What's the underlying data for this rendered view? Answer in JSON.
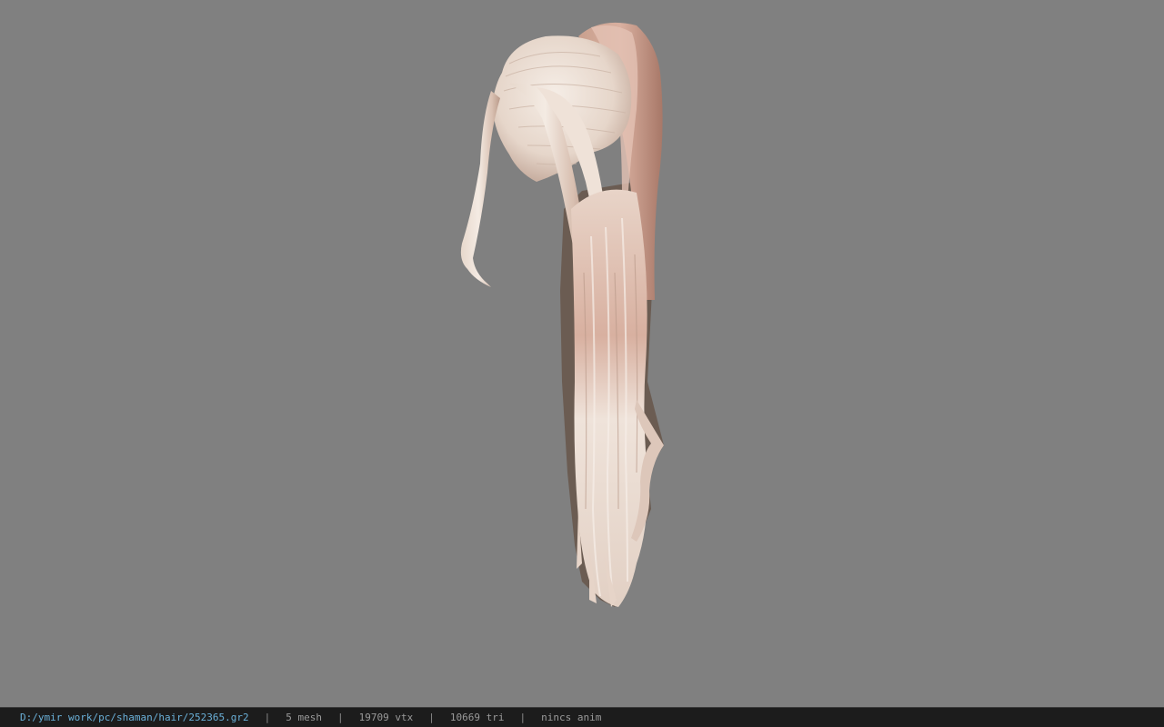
{
  "viewport": {
    "background": "#808080",
    "model": {
      "name": "hair-model",
      "colors": {
        "highlight": "#f2e6dc",
        "base": "#d9c2b3",
        "pink": "#cf9d8c",
        "shadow": "#5a5048"
      }
    }
  },
  "status_bar": {
    "file_path": "D:/ymir work/pc/shaman/hair/252365.gr2",
    "separator": "|",
    "mesh_count": "5 mesh",
    "vertex_count": "19709 vtx",
    "triangle_count": "10669 tri",
    "anim_status": "nincs anim",
    "path_color": "#6ab0d8",
    "text_color": "#9a9a9a"
  }
}
